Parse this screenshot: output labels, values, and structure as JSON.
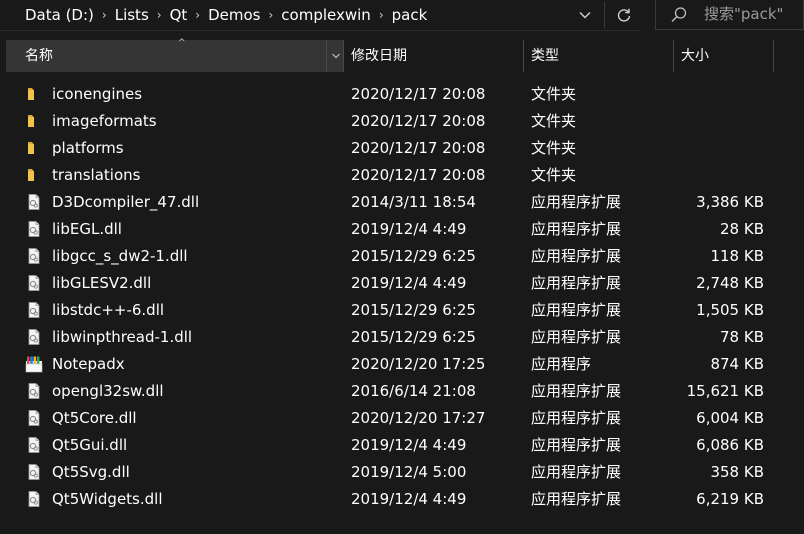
{
  "address": {
    "crumbs": [
      "Data (D:)",
      "Lists",
      "Qt",
      "Demos",
      "complexwin",
      "pack"
    ],
    "separator": "›",
    "history_icon": "chevron-down-icon",
    "refresh_icon": "refresh-icon"
  },
  "search": {
    "placeholder": "搜索\"pack\"",
    "icon": "search-icon"
  },
  "headers": {
    "name": "名称",
    "date": "修改日期",
    "type": "类型",
    "size": "大小",
    "sort_indicator": "^",
    "sorted_column": "name"
  },
  "colors": {
    "background": "#191919",
    "header_active": "#353535",
    "folder": "#f0c44a",
    "text": "#ffffff"
  },
  "files": [
    {
      "name": "iconengines",
      "date": "2020/12/17 20:08",
      "type": "文件夹",
      "size": "",
      "icon": "folder-icon"
    },
    {
      "name": "imageformats",
      "date": "2020/12/17 20:08",
      "type": "文件夹",
      "size": "",
      "icon": "folder-icon"
    },
    {
      "name": "platforms",
      "date": "2020/12/17 20:08",
      "type": "文件夹",
      "size": "",
      "icon": "folder-icon"
    },
    {
      "name": "translations",
      "date": "2020/12/17 20:08",
      "type": "文件夹",
      "size": "",
      "icon": "folder-icon"
    },
    {
      "name": "D3Dcompiler_47.dll",
      "date": "2014/3/11 18:54",
      "type": "应用程序扩展",
      "size": "3,386 KB",
      "icon": "dll-file-icon"
    },
    {
      "name": "libEGL.dll",
      "date": "2019/12/4 4:49",
      "type": "应用程序扩展",
      "size": "28 KB",
      "icon": "dll-file-icon"
    },
    {
      "name": "libgcc_s_dw2-1.dll",
      "date": "2015/12/29 6:25",
      "type": "应用程序扩展",
      "size": "118 KB",
      "icon": "dll-file-icon"
    },
    {
      "name": "libGLESV2.dll",
      "date": "2019/12/4 4:49",
      "type": "应用程序扩展",
      "size": "2,748 KB",
      "icon": "dll-file-icon"
    },
    {
      "name": "libstdc++-6.dll",
      "date": "2015/12/29 6:25",
      "type": "应用程序扩展",
      "size": "1,505 KB",
      "icon": "dll-file-icon"
    },
    {
      "name": "libwinpthread-1.dll",
      "date": "2015/12/29 6:25",
      "type": "应用程序扩展",
      "size": "78 KB",
      "icon": "dll-file-icon"
    },
    {
      "name": "Notepadx",
      "date": "2020/12/20 17:25",
      "type": "应用程序",
      "size": "874 KB",
      "icon": "app-icon"
    },
    {
      "name": "opengl32sw.dll",
      "date": "2016/6/14 21:08",
      "type": "应用程序扩展",
      "size": "15,621 KB",
      "icon": "dll-file-icon"
    },
    {
      "name": "Qt5Core.dll",
      "date": "2020/12/20 17:27",
      "type": "应用程序扩展",
      "size": "6,004 KB",
      "icon": "dll-file-icon"
    },
    {
      "name": "Qt5Gui.dll",
      "date": "2019/12/4 4:49",
      "type": "应用程序扩展",
      "size": "6,086 KB",
      "icon": "dll-file-icon"
    },
    {
      "name": "Qt5Svg.dll",
      "date": "2019/12/4 5:00",
      "type": "应用程序扩展",
      "size": "358 KB",
      "icon": "dll-file-icon"
    },
    {
      "name": "Qt5Widgets.dll",
      "date": "2019/12/4 4:49",
      "type": "应用程序扩展",
      "size": "6,219 KB",
      "icon": "dll-file-icon"
    }
  ]
}
